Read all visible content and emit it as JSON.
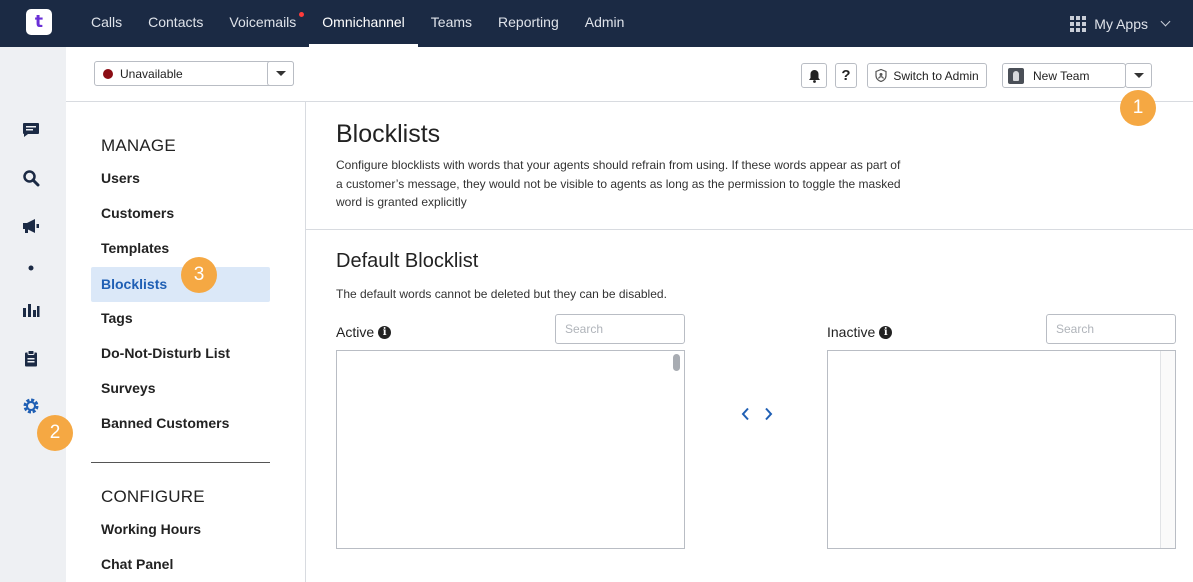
{
  "nav": {
    "logo_text": "t",
    "items": [
      {
        "label": "Calls",
        "name": "calls"
      },
      {
        "label": "Contacts",
        "name": "contacts"
      },
      {
        "label": "Voicemails",
        "name": "voicemails"
      },
      {
        "label": "Omnichannel",
        "name": "omnichannel"
      },
      {
        "label": "Teams",
        "name": "teams"
      },
      {
        "label": "Reporting",
        "name": "reporting"
      },
      {
        "label": "Admin",
        "name": "admin"
      }
    ],
    "active": "Omnichannel",
    "my_apps_label": "My Apps"
  },
  "rail": {
    "icons": [
      "chat-icon",
      "search-icon",
      "megaphone-icon",
      "dot-icon",
      "bar-chart-icon",
      "clipboard-icon",
      "gear-icon"
    ],
    "active": "gear-icon",
    "active_color": "#1f5fb4"
  },
  "toolbar": {
    "status_label": "Unavailable",
    "status_color": "#8b0d14",
    "bell_icon": "bell-icon",
    "help_label": "?",
    "switch_admin_label": "Switch to Admin",
    "team_label": "New Team"
  },
  "badges": {
    "one": "1",
    "two": "2",
    "three": "3",
    "color": "#f5a843"
  },
  "sidebar": {
    "manage_title": "MANAGE",
    "manage_items": [
      "Users",
      "Customers",
      "Templates",
      "Blocklists",
      "Tags",
      "Do-Not-Disturb List",
      "Surveys",
      "Banned Customers"
    ],
    "active_item": "Blocklists",
    "configure_title": "CONFIGURE",
    "configure_items": [
      "Working Hours",
      "Chat Panel"
    ]
  },
  "main": {
    "title": "Blocklists",
    "description": "Configure blocklists with words that your agents should refrain from using. If these words appear as part of a customer’s message, they would not be visible to agents as long as the permission to toggle the masked word is granted explicitly",
    "section_title": "Default Blocklist",
    "section_desc": "The default words cannot be deleted but they can be disabled.",
    "active_label": "Active",
    "inactive_label": "Inactive",
    "search_placeholder": "Search"
  }
}
